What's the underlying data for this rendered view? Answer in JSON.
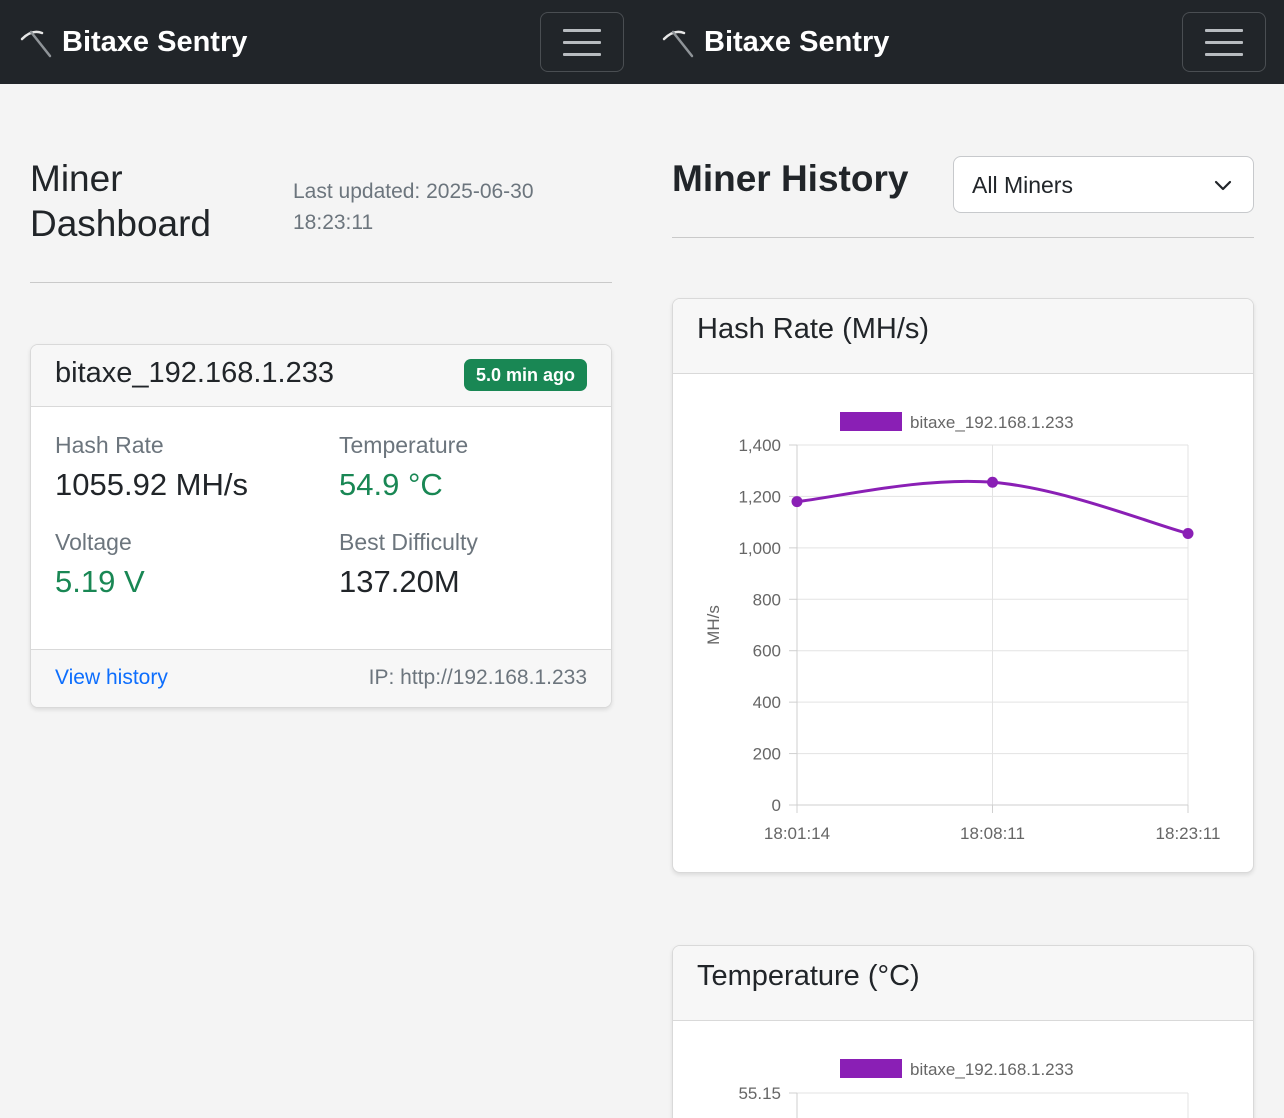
{
  "app": {
    "brand": "Bitaxe Sentry",
    "brand_icon": "pickaxe-icon",
    "menu_icon": "hamburger-menu-icon"
  },
  "colors": {
    "navbar": "#212529",
    "success": "#198754",
    "link": "#0d6efd",
    "series": "#8a1fb5"
  },
  "dashboard": {
    "title": "Miner Dashboard",
    "last_updated": "Last updated: 2025-06-30 18:23:11",
    "miner": {
      "name": "bitaxe_192.168.1.233",
      "badge": "5.0 min ago",
      "hash_rate_label": "Hash Rate",
      "hash_rate_value": "1055.92 MH/s",
      "temperature_label": "Temperature",
      "temperature_value": "54.9 °C",
      "voltage_label": "Voltage",
      "voltage_value": "5.19 V",
      "best_difficulty_label": "Best Difficulty",
      "best_difficulty_value": "137.20M",
      "view_history": "View history",
      "ip": "IP: http://192.168.1.233"
    }
  },
  "history": {
    "title": "Miner History",
    "select_value": "All Miners",
    "select_icon": "chevron-down-icon",
    "hash_rate_card_title": "Hash Rate (MH/s)",
    "temperature_card_title": "Temperature (°C)"
  },
  "chart_data": [
    {
      "type": "line",
      "title": "Hash Rate (MH/s)",
      "ylabel": "MH/s",
      "xlabel": "",
      "x": [
        "18:01:14",
        "18:08:11",
        "18:23:11"
      ],
      "series": [
        {
          "name": "bitaxe_192.168.1.233",
          "values": [
            1180,
            1255,
            1055.92
          ],
          "color": "#8a1fb5"
        }
      ],
      "ylim": [
        0,
        1400
      ],
      "yticks": [
        0,
        200,
        400,
        600,
        800,
        1000,
        1200,
        1400
      ],
      "yticklabels": [
        "0",
        "200",
        "400",
        "600",
        "800",
        "1,000",
        "1,200",
        "1,400"
      ],
      "grid": true,
      "legend": "top-center"
    },
    {
      "type": "line",
      "title": "Temperature (°C)",
      "series": [
        {
          "name": "bitaxe_192.168.1.233",
          "values": [],
          "color": "#8a1fb5"
        }
      ],
      "yticklabels": [
        "55.15"
      ],
      "legend": "top-center"
    }
  ]
}
